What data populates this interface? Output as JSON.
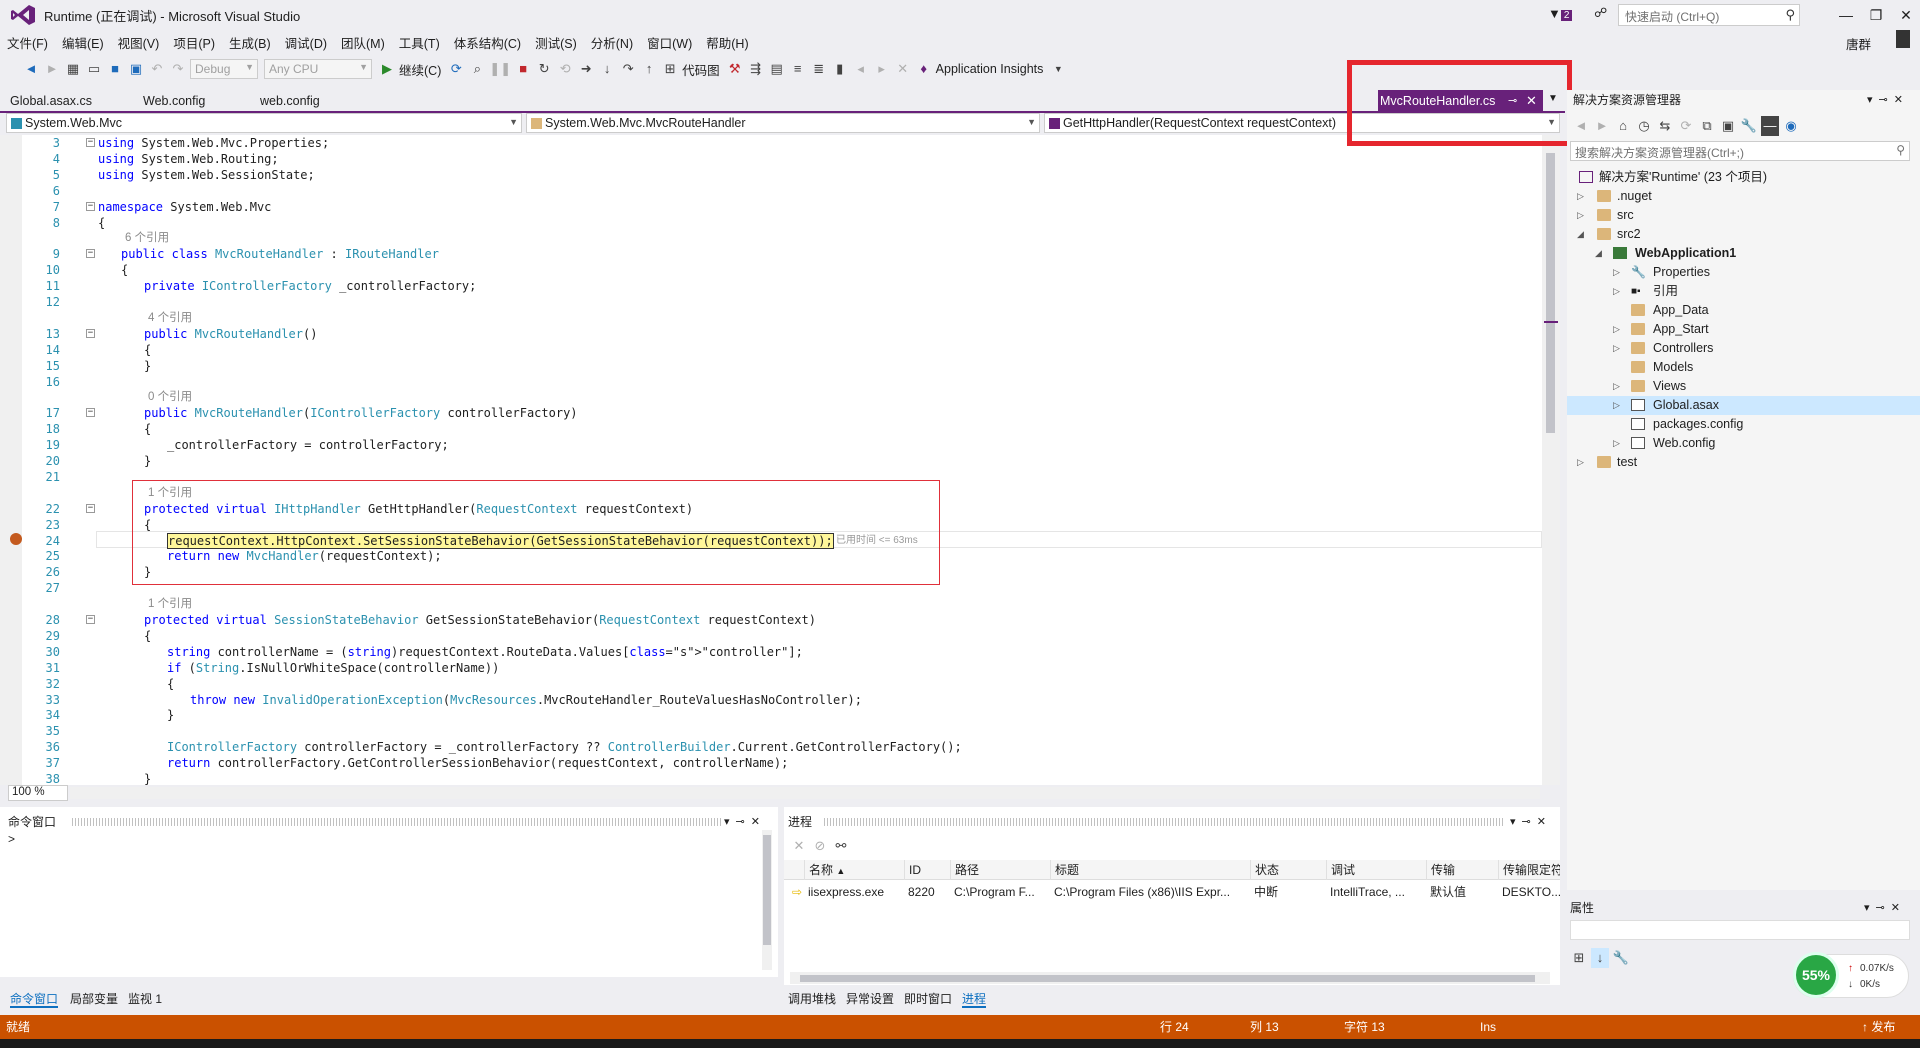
{
  "window": {
    "title": "Runtime (正在调试) - Microsoft Visual Studio",
    "notification_count": "2",
    "quick_launch_placeholder": "快速启动 (Ctrl+Q)",
    "user": "唐群"
  },
  "menu": [
    "文件(F)",
    "编辑(E)",
    "视图(V)",
    "项目(P)",
    "生成(B)",
    "调试(D)",
    "团队(M)",
    "工具(T)",
    "体系结构(C)",
    "测试(S)",
    "分析(N)",
    "窗口(W)",
    "帮助(H)"
  ],
  "toolbar": {
    "config": "Debug",
    "platform": "Any CPU",
    "continue_label": "继续(C)",
    "code_map_label": "代码图",
    "app_insights_label": "Application Insights"
  },
  "tabs": {
    "inactive": [
      "Global.asax.cs",
      "Web.config",
      "web.config"
    ],
    "active": "MvcRouteHandler.cs"
  },
  "navbar": {
    "project": "System.Web.Mvc",
    "type": "System.Web.Mvc.MvcRouteHandler",
    "member": "GetHttpHandler(RequestContext requestContext)"
  },
  "editor": {
    "zoom": "100 %",
    "elapsed_hint": "已用时间 <= 63ms",
    "lines": [
      {
        "n": "3",
        "code": "using System.Web.Mvc.Properties;"
      },
      {
        "n": "4",
        "code": "using System.Web.Routing;"
      },
      {
        "n": "5",
        "code": "using System.Web.SessionState;"
      },
      {
        "n": "6",
        "code": ""
      },
      {
        "n": "7",
        "code": "namespace System.Web.Mvc"
      },
      {
        "n": "8",
        "code": "{"
      },
      {
        "lens": "6 个引用"
      },
      {
        "n": "9",
        "code": "public class MvcRouteHandler : IRouteHandler"
      },
      {
        "n": "10",
        "code": "{"
      },
      {
        "n": "11",
        "code": "private IControllerFactory _controllerFactory;"
      },
      {
        "n": "12",
        "code": ""
      },
      {
        "lens": "4 个引用"
      },
      {
        "n": "13",
        "code": "public MvcRouteHandler()"
      },
      {
        "n": "14",
        "code": "{"
      },
      {
        "n": "15",
        "code": "}"
      },
      {
        "n": "16",
        "code": ""
      },
      {
        "lens": "0 个引用"
      },
      {
        "n": "17",
        "code": "public MvcRouteHandler(IControllerFactory controllerFactory)"
      },
      {
        "n": "18",
        "code": "{"
      },
      {
        "n": "19",
        "code": "_controllerFactory = controllerFactory;"
      },
      {
        "n": "20",
        "code": "}"
      },
      {
        "n": "21",
        "code": ""
      },
      {
        "lens": "1 个引用"
      },
      {
        "n": "22",
        "code": "protected virtual IHttpHandler GetHttpHandler(RequestContext requestContext)"
      },
      {
        "n": "23",
        "code": "{"
      },
      {
        "n": "24",
        "code": "requestContext.HttpContext.SetSessionStateBehavior(GetSessionStateBehavior(requestContext));"
      },
      {
        "n": "25",
        "code": "return new MvcHandler(requestContext);"
      },
      {
        "n": "26",
        "code": "}"
      },
      {
        "n": "27",
        "code": ""
      },
      {
        "lens": "1 个引用"
      },
      {
        "n": "28",
        "code": "protected virtual SessionStateBehavior GetSessionStateBehavior(RequestContext requestContext)"
      },
      {
        "n": "29",
        "code": "{"
      },
      {
        "n": "30",
        "code": "string controllerName = (string)requestContext.RouteData.Values[\"controller\"];"
      },
      {
        "n": "31",
        "code": "if (String.IsNullOrWhiteSpace(controllerName))"
      },
      {
        "n": "32",
        "code": "{"
      },
      {
        "n": "33",
        "code": "throw new InvalidOperationException(MvcResources.MvcRouteHandler_RouteValuesHasNoController);"
      },
      {
        "n": "34",
        "code": "}"
      },
      {
        "n": "35",
        "code": ""
      },
      {
        "n": "36",
        "code": "IControllerFactory controllerFactory = _controllerFactory ?? ControllerBuilder.Current.GetControllerFactory();"
      },
      {
        "n": "37",
        "code": "return controllerFactory.GetControllerSessionBehavior(requestContext, controllerName);"
      },
      {
        "n": "38",
        "code": "}"
      }
    ]
  },
  "solution_explorer": {
    "title": "解决方案资源管理器",
    "search_placeholder": "搜索解决方案资源管理器(Ctrl+;)",
    "items": [
      {
        "label": "解决方案'Runtime' (23 个项目)"
      },
      {
        "label": ".nuget"
      },
      {
        "label": "src"
      },
      {
        "label": "src2"
      },
      {
        "label": "WebApplication1"
      },
      {
        "label": "Properties"
      },
      {
        "label": "引用"
      },
      {
        "label": "App_Data"
      },
      {
        "label": "App_Start"
      },
      {
        "label": "Controllers"
      },
      {
        "label": "Models"
      },
      {
        "label": "Views"
      },
      {
        "label": "Global.asax"
      },
      {
        "label": "packages.config"
      },
      {
        "label": "Web.config"
      },
      {
        "label": "test"
      }
    ]
  },
  "properties": {
    "title": "属性"
  },
  "network_widget": {
    "percent": "55%",
    "upload": "0.07K/s",
    "download": "0K/s"
  },
  "command_window": {
    "title": "命令窗口",
    "prompt": ">"
  },
  "processes": {
    "title": "进程",
    "columns": [
      "名称",
      "ID",
      "路径",
      "标题",
      "状态",
      "调试",
      "传输",
      "传输限定符"
    ],
    "rows": [
      {
        "name": "iisexpress.exe",
        "id": "8220",
        "path": "C:\\Program F...",
        "title": "C:\\Program Files (x86)\\IIS Expr...",
        "state": "中断",
        "debug": "IntelliTrace, ...",
        "transport": "默认值",
        "qualifier": "DESKTO..."
      }
    ]
  },
  "bottom_tabs_left": [
    "命令窗口",
    "局部变量",
    "监视 1"
  ],
  "bottom_tabs_right": [
    "调用堆栈",
    "异常设置",
    "即时窗口",
    "进程"
  ],
  "statusbar": {
    "ready": "就绪",
    "row": "行 24",
    "col": "列 13",
    "char": "字符 13",
    "mode": "Ins",
    "publish": "↑ 发布"
  },
  "colors": {
    "accent": "#68217a",
    "status": "#ca5100",
    "annotation": "#e5262e"
  }
}
